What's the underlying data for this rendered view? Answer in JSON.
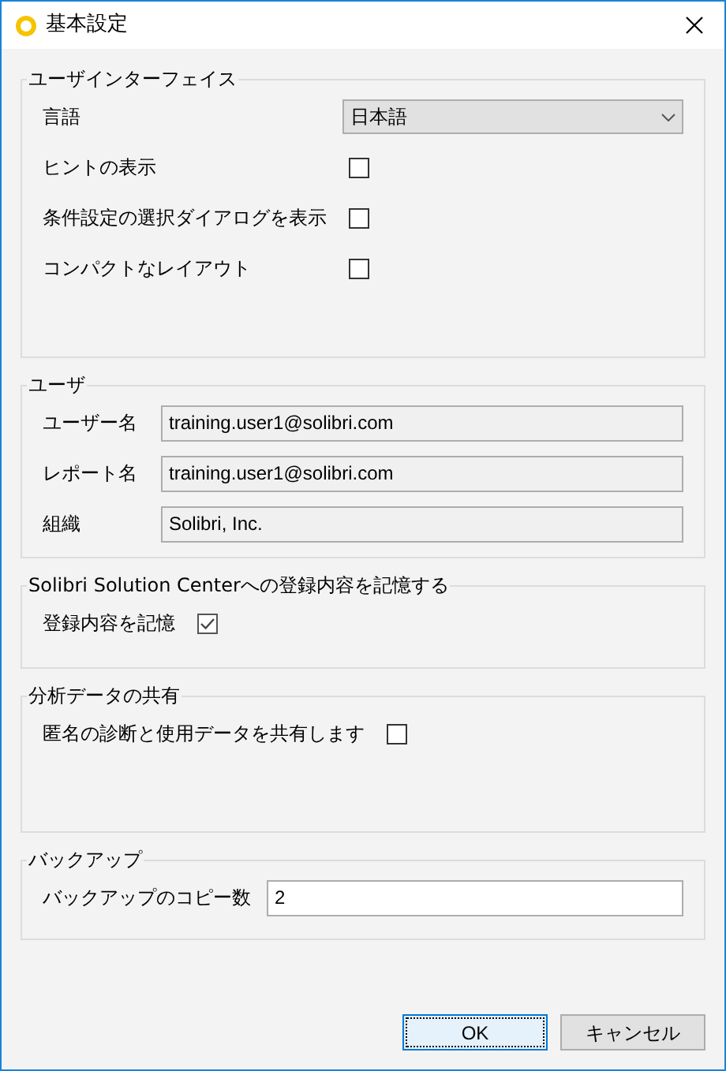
{
  "window": {
    "title": "基本設定"
  },
  "groups": [
    {
      "title": "ユーザインターフェイス",
      "rows": [
        {
          "kind": "dropdown",
          "label": "言語",
          "value": "日本語"
        },
        {
          "kind": "checkbox",
          "label": "ヒントの表示",
          "checked": false
        },
        {
          "kind": "checkbox",
          "label": "条件設定の選択ダイアログを表示",
          "checked": false
        },
        {
          "kind": "checkbox",
          "label": "コンパクトなレイアウト",
          "checked": false
        }
      ]
    },
    {
      "title": "ユーザ",
      "rows": [
        {
          "kind": "readonly",
          "label": "ユーザー名",
          "value": "training.user1@solibri.com"
        },
        {
          "kind": "readonly",
          "label": "レポート名",
          "value": "training.user1@solibri.com"
        },
        {
          "kind": "readonly",
          "label": "組織",
          "value": "Solibri, Inc."
        }
      ]
    },
    {
      "title": "Solibri Solution Centerへの登録内容を記憶する",
      "rows": [
        {
          "kind": "checkbox",
          "label": "登録内容を記憶",
          "checked": true
        }
      ]
    },
    {
      "title": "分析データの共有",
      "rows": [
        {
          "kind": "checkbox",
          "label": "匿名の診断と使用データを共有します",
          "checked": false
        }
      ]
    },
    {
      "title": "バックアップ",
      "rows": [
        {
          "kind": "input",
          "label": "バックアップのコピー数",
          "value": "2"
        }
      ]
    }
  ],
  "buttons": [
    {
      "label": "OK",
      "default": true
    },
    {
      "label": "キャンセル",
      "default": false
    }
  ]
}
